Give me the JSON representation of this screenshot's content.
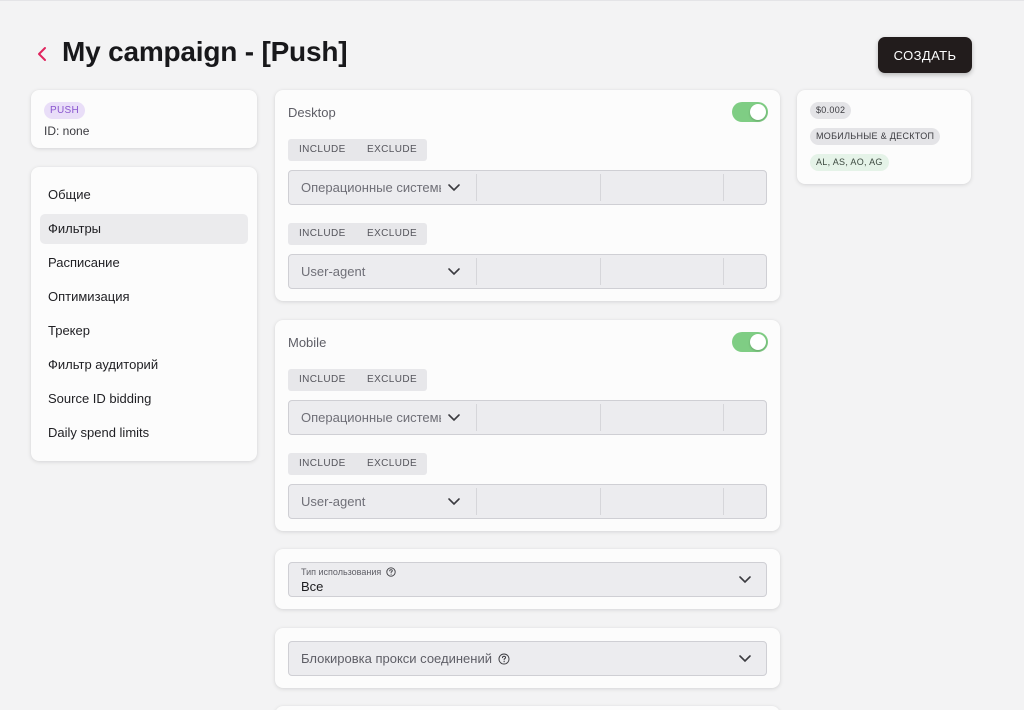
{
  "header": {
    "title": "My campaign - [Push]",
    "create_label": "СОЗДАТЬ"
  },
  "info": {
    "badge": "PUSH",
    "id_text": "ID: none"
  },
  "nav": {
    "items": [
      {
        "label": "Общие"
      },
      {
        "label": "Фильтры"
      },
      {
        "label": "Расписание"
      },
      {
        "label": "Оптимизация"
      },
      {
        "label": "Трекер"
      },
      {
        "label": "Фильтр аудиторий"
      },
      {
        "label": "Source ID bidding"
      },
      {
        "label": "Daily spend limits"
      }
    ],
    "active": "Фильтры"
  },
  "desktop": {
    "title": "Desktop",
    "toggle_on": true,
    "include_label": "INCLUDE",
    "exclude_label": "EXCLUDE",
    "os_select": "Операционные системы",
    "ua_select": "User-agent"
  },
  "mobile": {
    "title": "Mobile",
    "toggle_on": true,
    "include_label": "INCLUDE",
    "exclude_label": "EXCLUDE",
    "os_select": "Операционные системы",
    "ua_select": "User-agent"
  },
  "usage_type": {
    "label": "Тип использования",
    "value": "Все"
  },
  "proxy_block": {
    "placeholder": "Блокировка прокси соединений"
  },
  "summary": {
    "price": "$0.002",
    "device": "МОБИЛЬНЫЕ & ДЕСКТОП",
    "geo": "AL, AS, AO, AG"
  },
  "colors": {
    "accent_back": "#e0245e",
    "toggle_on": "#7fcd84",
    "create_bg": "#221c1c",
    "push_badge_bg": "#e9def8",
    "push_badge_text": "#8a56cf"
  },
  "icons": {
    "back": "chevron-left-icon",
    "dropdown": "chevron-down-icon",
    "help": "question-circle-icon"
  }
}
